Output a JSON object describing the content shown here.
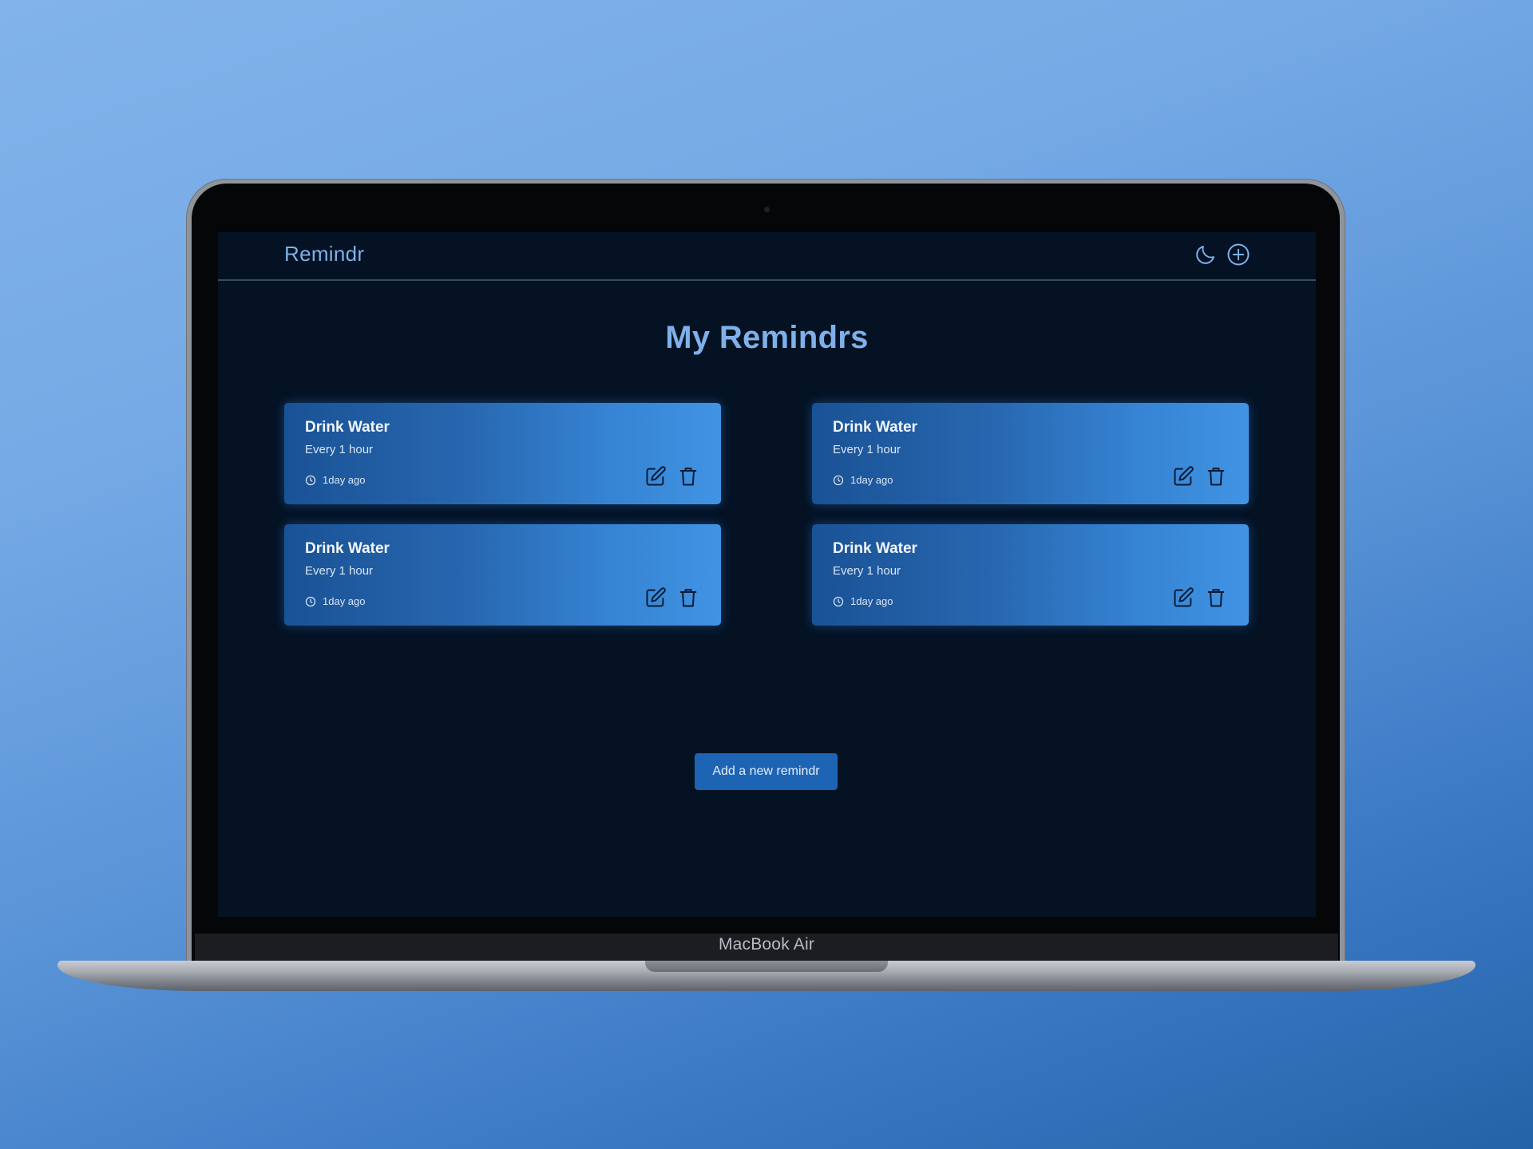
{
  "app": {
    "brand": "Remindr",
    "nav_icons": [
      "moon-icon",
      "plus-circle-icon"
    ]
  },
  "main": {
    "title": "My Remindrs",
    "add_button_label": "Add a new remindr",
    "reminders": [
      {
        "title": "Drink Water",
        "frequency": "Every 1 hour",
        "time_ago": "1day ago"
      },
      {
        "title": "Drink Water",
        "frequency": "Every 1 hour",
        "time_ago": "1day ago"
      },
      {
        "title": "Drink Water",
        "frequency": "Every 1 hour",
        "time_ago": "1day ago"
      },
      {
        "title": "Drink Water",
        "frequency": "Every 1 hour",
        "time_ago": "1day ago"
      }
    ]
  },
  "device": {
    "label": "MacBook Air"
  },
  "colors": {
    "background": "#041223",
    "accent": "#7fb0ea",
    "button": "#1e64b4",
    "card_start": "#1a5296",
    "card_end": "#4193e3"
  }
}
